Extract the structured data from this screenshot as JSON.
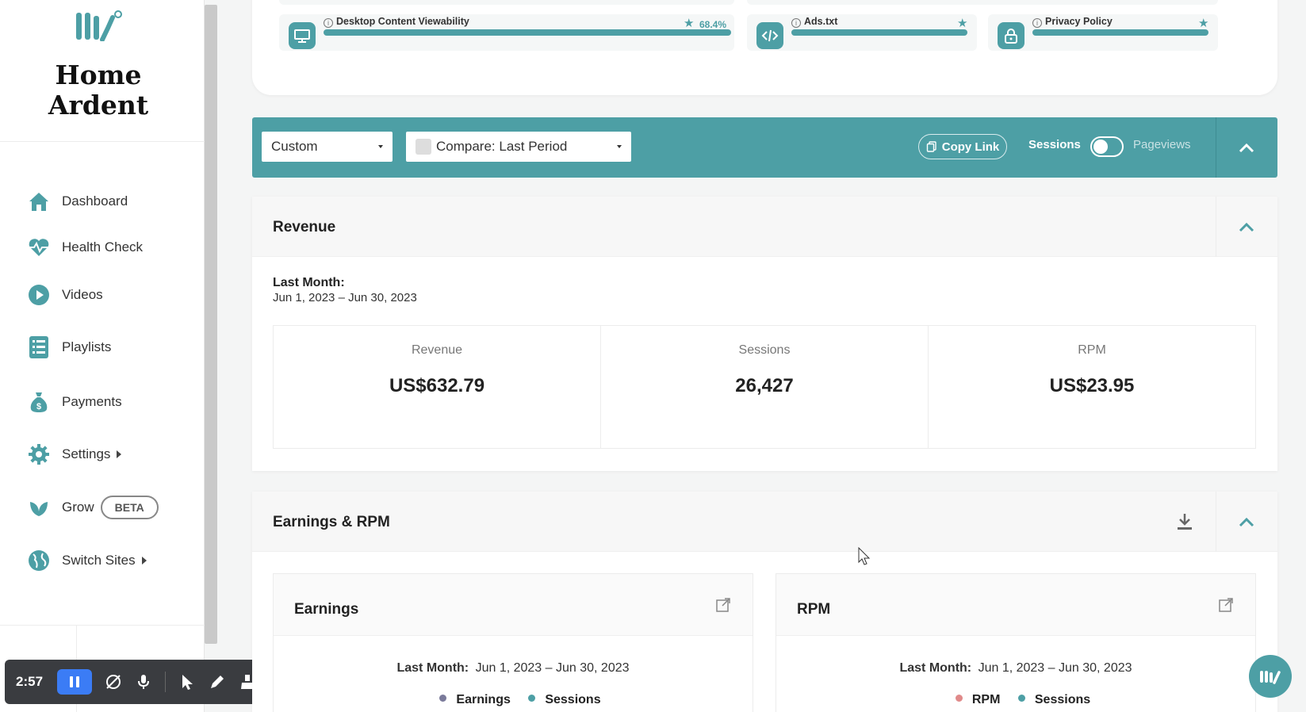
{
  "sidebar": {
    "brand_line1": "Home",
    "brand_line2": "Ardent",
    "items": [
      {
        "label": "Dashboard",
        "icon": "home-icon"
      },
      {
        "label": "Health Check",
        "icon": "heartbeat-icon"
      },
      {
        "label": "Videos",
        "icon": "play-circle-icon"
      },
      {
        "label": "Playlists",
        "icon": "list-icon"
      },
      {
        "label": "Payments",
        "icon": "money-bag-icon"
      },
      {
        "label": "Settings",
        "icon": "gear-icon"
      },
      {
        "label": "Grow",
        "icon": "leaf-icon",
        "badge": "BETA"
      },
      {
        "label": "Switch Sites",
        "icon": "globe-icon"
      }
    ]
  },
  "recorder": {
    "time": "2:57"
  },
  "health_checks": [
    {
      "label": "Desktop Content Viewability",
      "percent": "68.4%",
      "icon": "monitor-icon"
    },
    {
      "label": "Ads.txt",
      "icon": "code-icon"
    },
    {
      "label": "Privacy Policy",
      "icon": "lock-icon"
    }
  ],
  "filters": {
    "range": "Custom",
    "compare": "Compare: Last Period",
    "copy_link": "Copy Link",
    "toggle_left": "Sessions",
    "toggle_right": "Pageviews"
  },
  "revenue": {
    "title": "Revenue",
    "last_month_label": "Last Month:",
    "range": "Jun 1, 2023 – Jun 30, 2023",
    "metrics": [
      {
        "label": "Revenue",
        "value": "US$632.79"
      },
      {
        "label": "Sessions",
        "value": "26,427"
      },
      {
        "label": "RPM",
        "value": "US$23.95"
      }
    ]
  },
  "earnings_rpm": {
    "title": "Earnings & RPM",
    "earnings": {
      "title": "Earnings",
      "last_month_label": "Last Month:",
      "range": "Jun 1, 2023 – Jun 30, 2023",
      "legend": [
        {
          "label": "Earnings",
          "color": "#7a7a9a"
        },
        {
          "label": "Sessions",
          "color": "#4d9fa5"
        }
      ]
    },
    "rpm": {
      "title": "RPM",
      "last_month_label": "Last Month:",
      "range": "Jun 1, 2023 – Jun 30, 2023",
      "legend": [
        {
          "label": "RPM",
          "color": "#e08a8a"
        },
        {
          "label": "Sessions",
          "color": "#4d9fa5"
        }
      ]
    }
  },
  "colors": {
    "accent": "#4d9fa5"
  }
}
